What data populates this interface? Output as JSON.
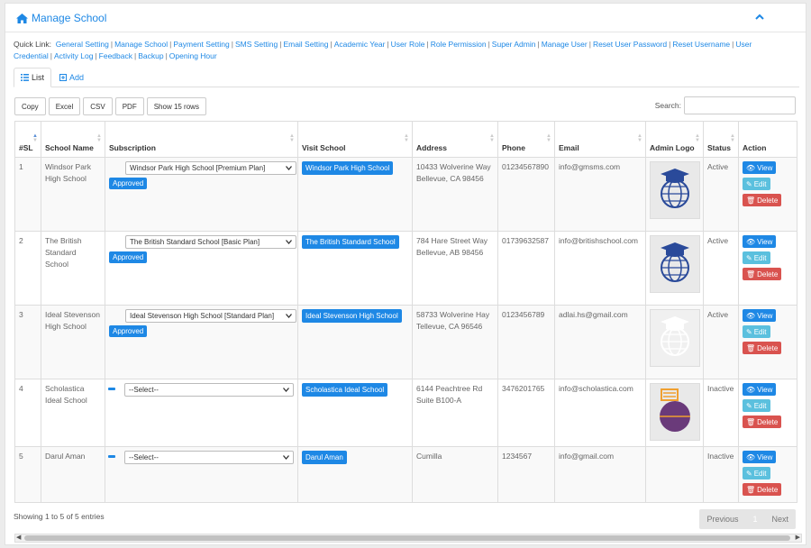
{
  "header": {
    "title": "Manage School",
    "home_icon": "home-icon",
    "collapse_icon": "chevron-up-icon"
  },
  "quicklink": {
    "label": "Quick Link:",
    "items": [
      "General Setting",
      "Manage School",
      "Payment Setting",
      "SMS Setting",
      "Email Setting",
      "Academic Year",
      "User Role",
      "Role Permission",
      "Super Admin",
      "Manage User",
      "Reset User Password",
      "Reset Username",
      "User Credential",
      "Activity Log",
      "Feedback",
      "Backup",
      "Opening Hour"
    ]
  },
  "tabs": {
    "list": "List",
    "add": "Add"
  },
  "buttons": {
    "copy": "Copy",
    "excel": "Excel",
    "csv": "CSV",
    "pdf": "PDF",
    "show": "Show 15 rows"
  },
  "search": {
    "label": "Search:",
    "value": ""
  },
  "columns": [
    "#SL",
    "School Name",
    "Subscription",
    "Visit School",
    "Address",
    "Phone",
    "Email",
    "Admin Logo",
    "Status",
    "Action"
  ],
  "rows": [
    {
      "sl": "1",
      "name": "Windsor Park High School",
      "subscription": "Windsor Park High School [Premium Plan]",
      "approved": "Approved",
      "visit": "Windsor Park High School",
      "address": "10433 Wolverine Way Bellevue, CA 98456",
      "phone": "01234567890",
      "email": "info@gmsms.com",
      "logo": "globe-logo-blue",
      "status": "Active"
    },
    {
      "sl": "2",
      "name": "The British Standard School",
      "subscription": "The British Standard School [Basic Plan]",
      "approved": "Approved",
      "visit": "The British Standard School",
      "address": "784 Hare Street Way Bellevue, AB 98456",
      "phone": "01739632587",
      "email": "info@britishschool.com",
      "logo": "globe-logo-blue",
      "status": "Active"
    },
    {
      "sl": "3",
      "name": "Ideal Stevenson High School",
      "subscription": "Ideal Stevenson High School [Standard Plan]",
      "approved": "Approved",
      "visit": "Ideal Stevenson High School",
      "address": "58733 Wolverine Hay Tellevue, CA 96546",
      "phone": "0123456789",
      "email": "adlai.hs@gmail.com",
      "logo": "globe-logo-white",
      "status": "Active"
    },
    {
      "sl": "4",
      "name": "Scholastica Ideal School",
      "subscription": "--Select--",
      "approved": "",
      "visit": "Scholastica Ideal School",
      "address": "6144 Peachtree Rd Suite B100-A",
      "phone": "3476201765",
      "email": "info@scholastica.com",
      "logo": "global-hotel-logo",
      "status": "Inactive"
    },
    {
      "sl": "5",
      "name": "Darul Aman",
      "subscription": "--Select--",
      "approved": "",
      "visit": "Darul Aman",
      "address": "Cumilla",
      "phone": "1234567",
      "email": "info@gmail.com",
      "logo": "",
      "status": "Inactive"
    }
  ],
  "actions": {
    "view": "View",
    "edit": "Edit",
    "delete": "Delete"
  },
  "footer": {
    "info": "Showing 1 to 5 of 5 entries",
    "previous": "Previous",
    "page": "1",
    "next": "Next"
  },
  "colors": {
    "accent": "#1e88e5",
    "edit": "#5bc0de",
    "delete": "#d9534f"
  }
}
